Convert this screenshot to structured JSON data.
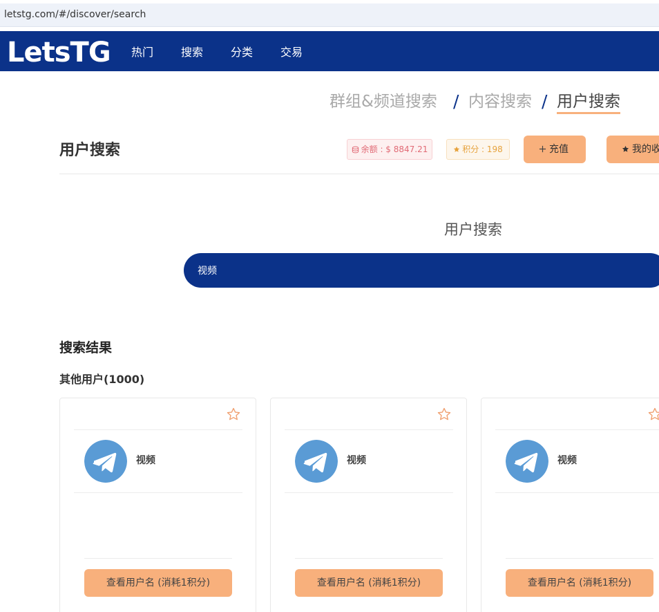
{
  "browser": {
    "url": "letstg.com/#/discover/search"
  },
  "nav": {
    "logo": "LetsTG",
    "items": [
      {
        "label": "热门"
      },
      {
        "label": "搜索"
      },
      {
        "label": "分类"
      },
      {
        "label": "交易"
      }
    ]
  },
  "tabs": [
    {
      "label": "群组&频道搜索"
    },
    {
      "label": "内容搜索"
    },
    {
      "label": "用户搜索"
    }
  ],
  "tab_separator": "/",
  "header": {
    "title": "用户搜索",
    "balance": "余额 : $ 8847.21",
    "points": "积分 : 198",
    "recharge_label": "充值",
    "favorites_label": "我的收藏"
  },
  "search": {
    "heading": "用户搜索",
    "value": "视频"
  },
  "results": {
    "title": "搜索结果",
    "subtitle": "其他用户(1000)",
    "cards": [
      {
        "name": "视频",
        "button": "查看用户名 (消耗1积分)"
      },
      {
        "name": "视频",
        "button": "查看用户名 (消耗1积分)"
      },
      {
        "name": "视频",
        "button": "查看用户名 (消耗1积分)"
      }
    ]
  },
  "colors": {
    "brand_navy": "#0b3289",
    "accent_orange": "#f8b07c",
    "balance_red": "#e16b76",
    "points_gold": "#e6a23c",
    "telegram_blue": "#5a9bd5"
  }
}
